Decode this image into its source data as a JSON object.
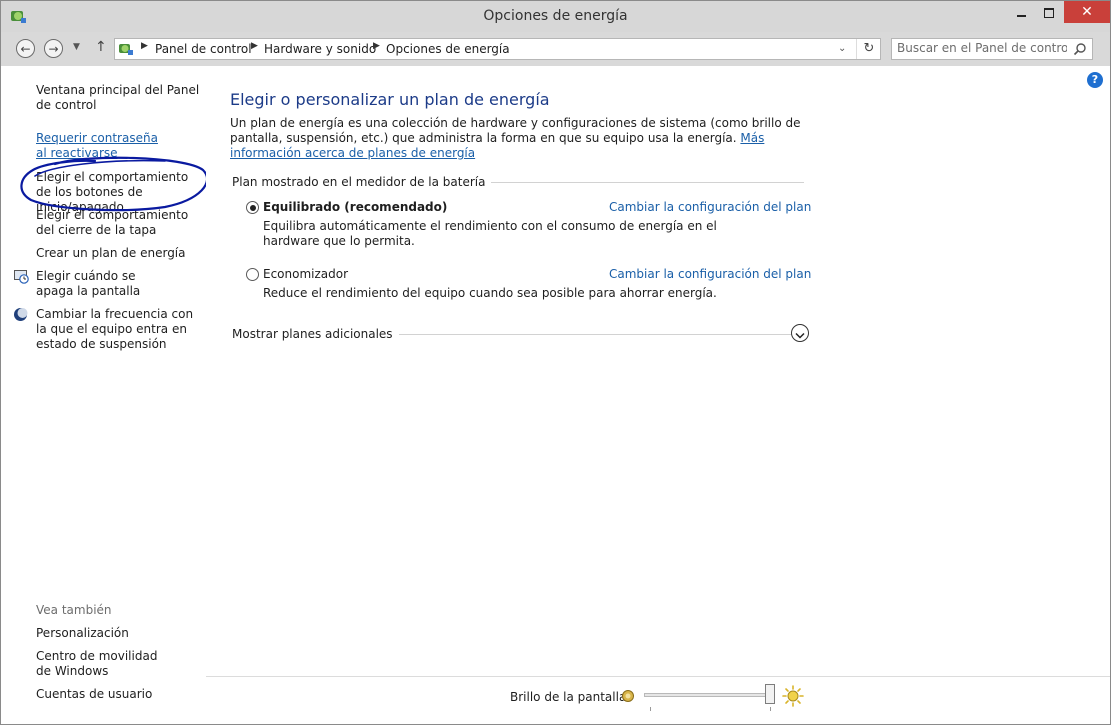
{
  "window": {
    "title": "Opciones de energía",
    "close_glyph": "✕"
  },
  "address_bar": {
    "breadcrumbs": [
      "Panel de control",
      "Hardware y sonido",
      "Opciones de energía"
    ],
    "search_placeholder": "Buscar en el Panel de control"
  },
  "sidebar": {
    "home_link": "Ventana principal del Panel de control",
    "tasks": [
      {
        "label": "Requerir contraseña al reactivarse",
        "icon": null
      },
      {
        "label": "Elegir el comportamiento de los botones de inicio/apagado",
        "icon": null
      },
      {
        "label": "Elegir el comportamiento del cierre de la tapa",
        "icon": null
      },
      {
        "label": "Crear un plan de energía",
        "icon": null
      },
      {
        "label": "Elegir cuándo se apaga la pantalla",
        "icon": "monitor-clock-icon"
      },
      {
        "label": "Cambiar la frecuencia con la que el equipo entra en estado de suspensión",
        "icon": "moon-icon"
      }
    ],
    "see_also_heading": "Vea también",
    "see_also": [
      "Personalización",
      "Centro de movilidad de Windows",
      "Cuentas de usuario"
    ]
  },
  "main": {
    "title": "Elegir o personalizar un plan de energía",
    "intro_text": "Un plan de energía es una colección de hardware y configuraciones de sistema (como brillo de pantalla, suspensión, etc.) que administra la forma en que su equipo usa la energía.",
    "intro_link": "Más información acerca de planes de energía",
    "group_heading": "Plan mostrado en el medidor de la batería",
    "plans": [
      {
        "name": "Equilibrado (recomendado)",
        "selected": true,
        "description": "Equilibra automáticamente el rendimiento con el consumo de energía en el hardware que lo permita.",
        "change_link": "Cambiar la configuración del plan"
      },
      {
        "name": "Economizador",
        "selected": false,
        "description": "Reduce el rendimiento del equipo cuando sea posible para ahorrar energía.",
        "change_link": "Cambiar la configuración del plan"
      }
    ],
    "more_plans_label": "Mostrar planes adicionales"
  },
  "bottom_bar": {
    "brightness_label": "Brillo de la pantalla:",
    "brightness_level": 0.95
  },
  "colors": {
    "link": "#1a5fa8",
    "title": "#1c3b88",
    "close_button": "#c9403a",
    "annotation_circle": "#0a1aa0"
  }
}
